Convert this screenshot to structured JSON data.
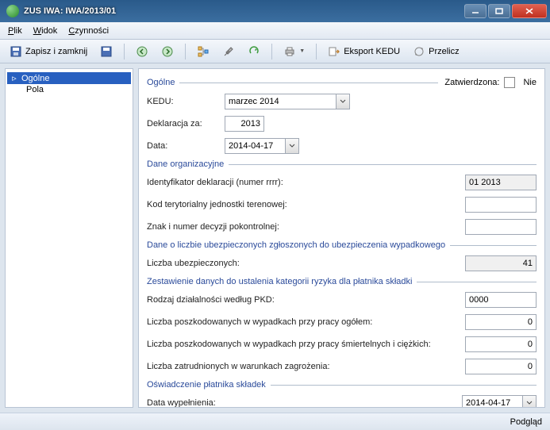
{
  "window": {
    "title": "ZUS IWA: IWA/2013/01"
  },
  "menu": {
    "plik": "Plik",
    "widok": "Widok",
    "czynnosci": "Czynności"
  },
  "toolbar": {
    "save_close": "Zapisz i zamknij",
    "export_kedu": "Eksport KEDU",
    "przelicz": "Przelicz"
  },
  "tree": {
    "ogolne": "Ogólne",
    "pola": "Pola"
  },
  "form": {
    "grp_ogolne": "Ogólne",
    "zatwierdzona_lbl": "Zatwierdzona:",
    "zatwierdzona_val": "Nie",
    "kedu_lbl": "KEDU:",
    "kedu_val": "marzec 2014",
    "deklaracja_lbl": "Deklaracja za:",
    "deklaracja_val": "2013",
    "data_lbl": "Data:",
    "data_val": "2014-04-17",
    "grp_org": "Dane organizacyjne",
    "ident_lbl": "Identyfikator deklaracji (numer rrrr):",
    "ident_val": "01 2013",
    "kod_lbl": "Kod terytorialny jednostki terenowej:",
    "kod_val": "",
    "znak_lbl": "Znak i numer decyzji pokontrolnej:",
    "znak_val": "",
    "grp_ubezp": "Dane o liczbie ubezpieczonych zgłoszonych do ubezpieczenia wypadkowego",
    "liczba_ubezp_lbl": "Liczba ubezpieczonych:",
    "liczba_ubezp_val": "41",
    "grp_zest": "Zestawienie danych do ustalenia kategorii ryzyka dla płatnika składki",
    "pkd_lbl": "Rodzaj działalności według PKD:",
    "pkd_val": "0000",
    "poszk_og_lbl": "Liczba poszkodowanych w wypadkach przy pracy ogółem:",
    "poszk_og_val": "0",
    "poszk_sc_lbl": "Liczba poszkodowanych w wypadkach przy pracy śmiertelnych i ciężkich:",
    "poszk_sc_val": "0",
    "zagr_lbl": "Liczba zatrudnionych w warunkach zagrożenia:",
    "zagr_val": "0",
    "grp_osw": "Oświadczenie płatnika składek",
    "data_wyp_lbl": "Data wypełnienia:",
    "data_wyp_val": "2014-04-17"
  },
  "status": {
    "podglad": "Podgląd"
  }
}
